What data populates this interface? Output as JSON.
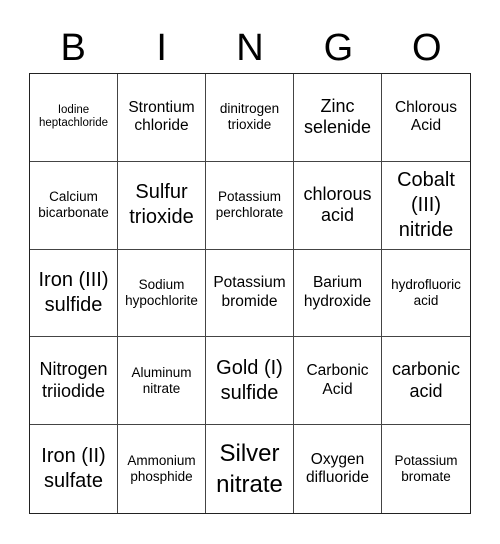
{
  "header": {
    "letters": [
      "B",
      "I",
      "N",
      "G",
      "O"
    ]
  },
  "grid": {
    "rows": [
      [
        {
          "text": "Iodine heptachloride",
          "size": "xs"
        },
        {
          "text": "Strontium chloride",
          "size": "md"
        },
        {
          "text": "dinitrogen trioxide",
          "size": "sm"
        },
        {
          "text": "Zinc selenide",
          "size": "lg"
        },
        {
          "text": "Chlorous Acid",
          "size": "md"
        }
      ],
      [
        {
          "text": "Calcium bicarbonate",
          "size": "sm"
        },
        {
          "text": "Sulfur trioxide",
          "size": "xl"
        },
        {
          "text": "Potassium perchlorate",
          "size": "sm"
        },
        {
          "text": "chlorous acid",
          "size": "lg"
        },
        {
          "text": "Cobalt (III) nitride",
          "size": "xl"
        }
      ],
      [
        {
          "text": "Iron (III) sulfide",
          "size": "xl"
        },
        {
          "text": "Sodium hypochlorite",
          "size": "sm"
        },
        {
          "text": "Potassium bromide",
          "size": "md"
        },
        {
          "text": "Barium hydroxide",
          "size": "md"
        },
        {
          "text": "hydrofluoric acid",
          "size": "sm"
        }
      ],
      [
        {
          "text": "Nitrogen triiodide",
          "size": "lg"
        },
        {
          "text": "Aluminum nitrate",
          "size": "sm"
        },
        {
          "text": "Gold (I) sulfide",
          "size": "xl"
        },
        {
          "text": "Carbonic Acid",
          "size": "md"
        },
        {
          "text": "carbonic acid",
          "size": "lg"
        }
      ],
      [
        {
          "text": "Iron (II) sulfate",
          "size": "xl"
        },
        {
          "text": "Ammonium phosphide",
          "size": "sm"
        },
        {
          "text": "Silver nitrate",
          "size": "xxl"
        },
        {
          "text": "Oxygen difluoride",
          "size": "md"
        },
        {
          "text": "Potassium bromate",
          "size": "sm"
        }
      ]
    ]
  }
}
